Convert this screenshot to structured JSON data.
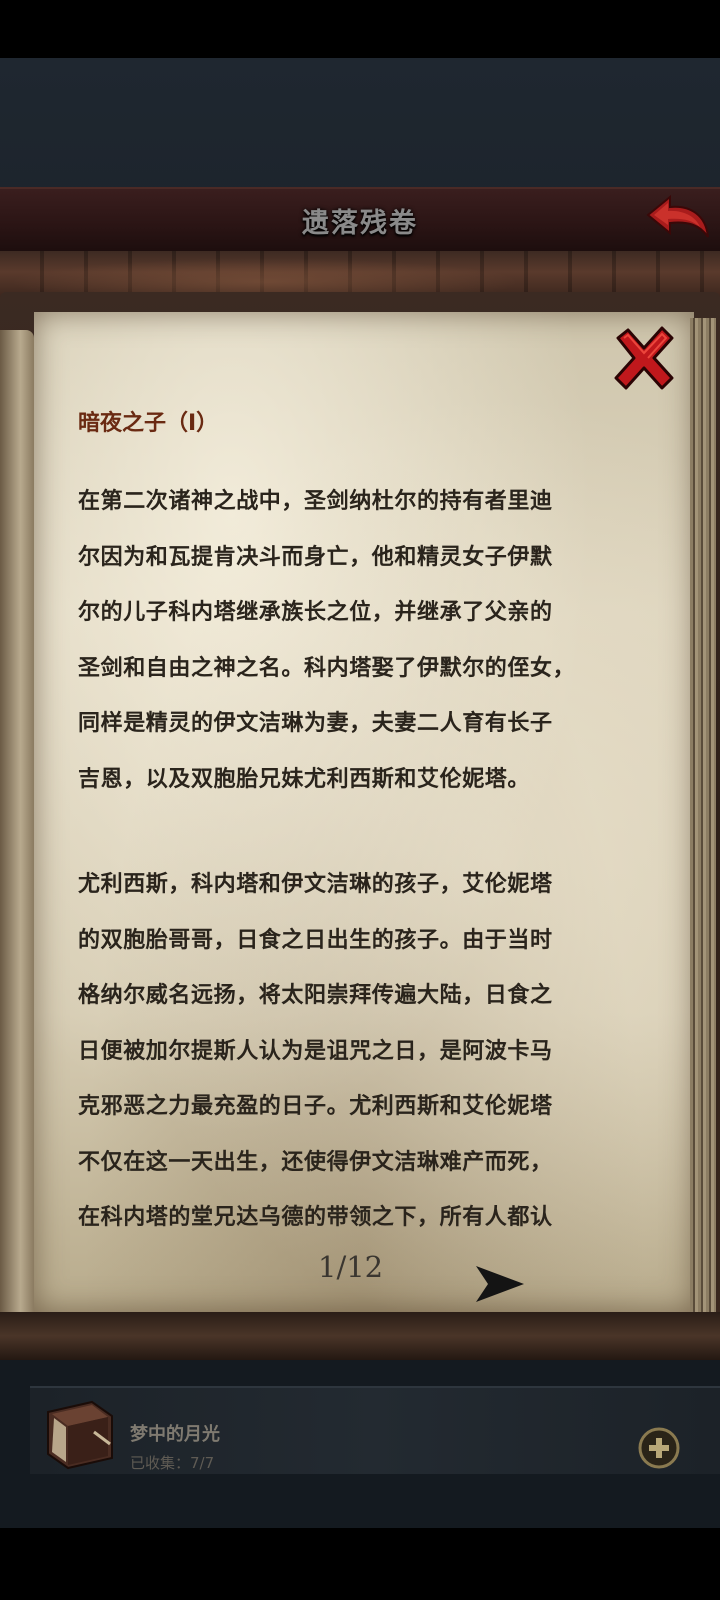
{
  "header": {
    "title": "遗落残卷"
  },
  "scroll": {
    "chapter_title": "暗夜之子（Ⅰ）",
    "paragraph1_lines": [
      "在第二次诸神之战中，圣剑纳杜尔的持有者里迪",
      "尔因为和瓦提肯决斗而身亡，他和精灵女子伊默",
      "尔的儿子科内塔继承族长之位，并继承了父亲的",
      "圣剑和自由之神之名。科内塔娶了伊默尔的侄女，",
      "同样是精灵的伊文洁琳为妻，夫妻二人育有长子",
      "吉恩，以及双胞胎兄妹尤利西斯和艾伦妮塔。"
    ],
    "paragraph2_lines": [
      "尤利西斯，科内塔和伊文洁琳的孩子，艾伦妮塔",
      "的双胞胎哥哥，日食之日出生的孩子。由于当时",
      "格纳尔威名远扬，将太阳崇拜传遍大陆，日食之",
      "日便被加尔提斯人认为是诅咒之日，是阿波卡马",
      "克邪恶之力最充盈的日子。尤利西斯和艾伦妮塔",
      "不仅在这一天出生，还使得伊文洁琳难产而死，",
      "在科内塔的堂兄达乌德的带领之下，所有人都认"
    ],
    "page_indicator": "1/12"
  },
  "collection": {
    "name": "梦中的月光",
    "progress": "已收集：7/7"
  },
  "icons": {
    "back": "back-arrow-icon",
    "close": "close-x-icon",
    "next": "next-page-arrow-icon",
    "book": "book-icon",
    "add": "plus-circle-icon"
  },
  "colors": {
    "chapter_title": "#6a2a12",
    "body_text": "#2a241c",
    "close_x": "#c0181c",
    "back_arrow": "#b01c1c"
  }
}
